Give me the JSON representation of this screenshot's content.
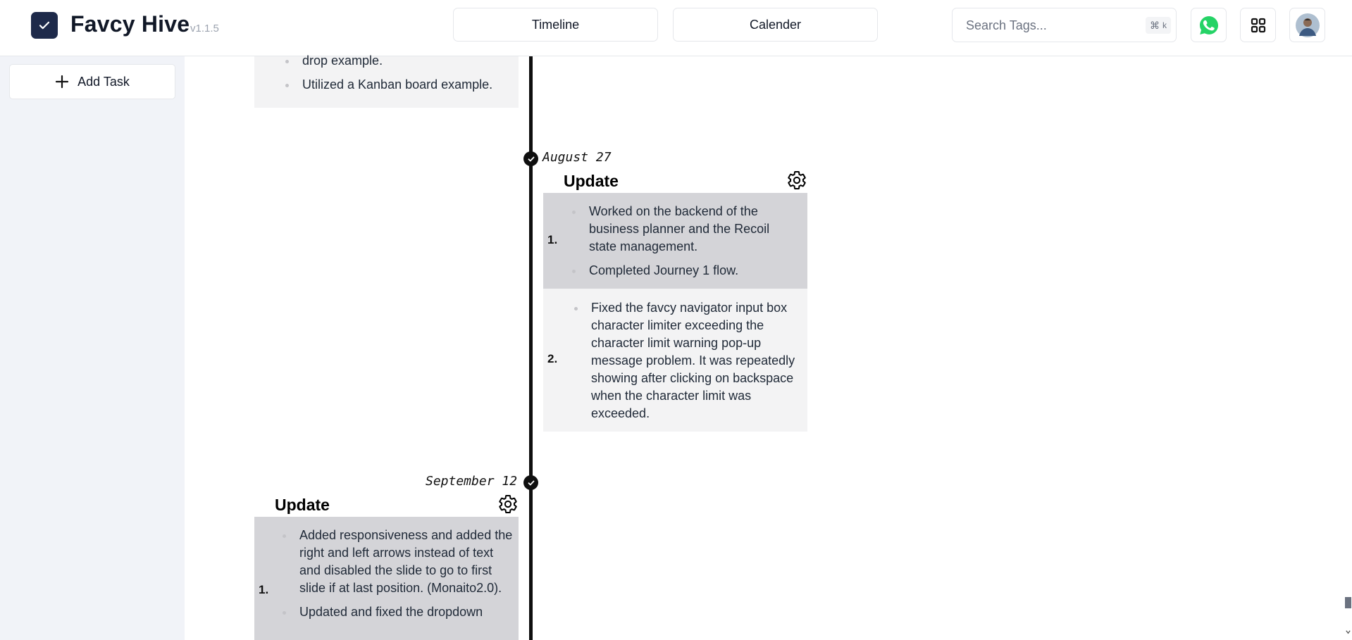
{
  "header": {
    "app_name": "Favcy Hive",
    "version": "v1.1.5",
    "tabs": [
      "Timeline",
      "Calender"
    ],
    "search": {
      "placeholder": "Search Tags...",
      "shortcut_symbol": "⌘",
      "shortcut_key": "k"
    },
    "icons": [
      "whatsapp-icon",
      "grid-icon",
      "avatar"
    ]
  },
  "sidebar": {
    "add_task_label": "Add Task"
  },
  "timeline": {
    "entries": [
      {
        "date": "",
        "blocks": [
          {
            "number": "",
            "items": [
              "drop example.",
              "Utilized a Kanban board example."
            ]
          }
        ]
      },
      {
        "date": "August 27",
        "title": "Update",
        "blocks": [
          {
            "number": "1.",
            "items": [
              "Worked on the backend of the business planner and the Recoil state management.",
              "Completed Journey 1 flow."
            ]
          },
          {
            "number": "2.",
            "items": [
              "Fixed the favcy navigator input box character limiter exceeding the character limit warning pop-up message problem. It was repeatedly showing after clicking on backspace when the character limit was exceeded."
            ]
          }
        ]
      },
      {
        "date": "September 12",
        "title": "Update",
        "blocks": [
          {
            "number": "1.",
            "items": [
              "Added responsiveness and added the right and left arrows instead of text and disabled the slide to go to first slide if at last position. (Monaito2.0).",
              "Updated and fixed the dropdown"
            ]
          }
        ]
      }
    ]
  },
  "colors": {
    "logo_bg": "#1e2a4a",
    "timeline": "#0f0f0f",
    "whatsapp": "#25d366",
    "block_dark": "#d4d4d8",
    "block_light": "#f3f3f4",
    "sidebar_bg": "#f1f3f8"
  }
}
